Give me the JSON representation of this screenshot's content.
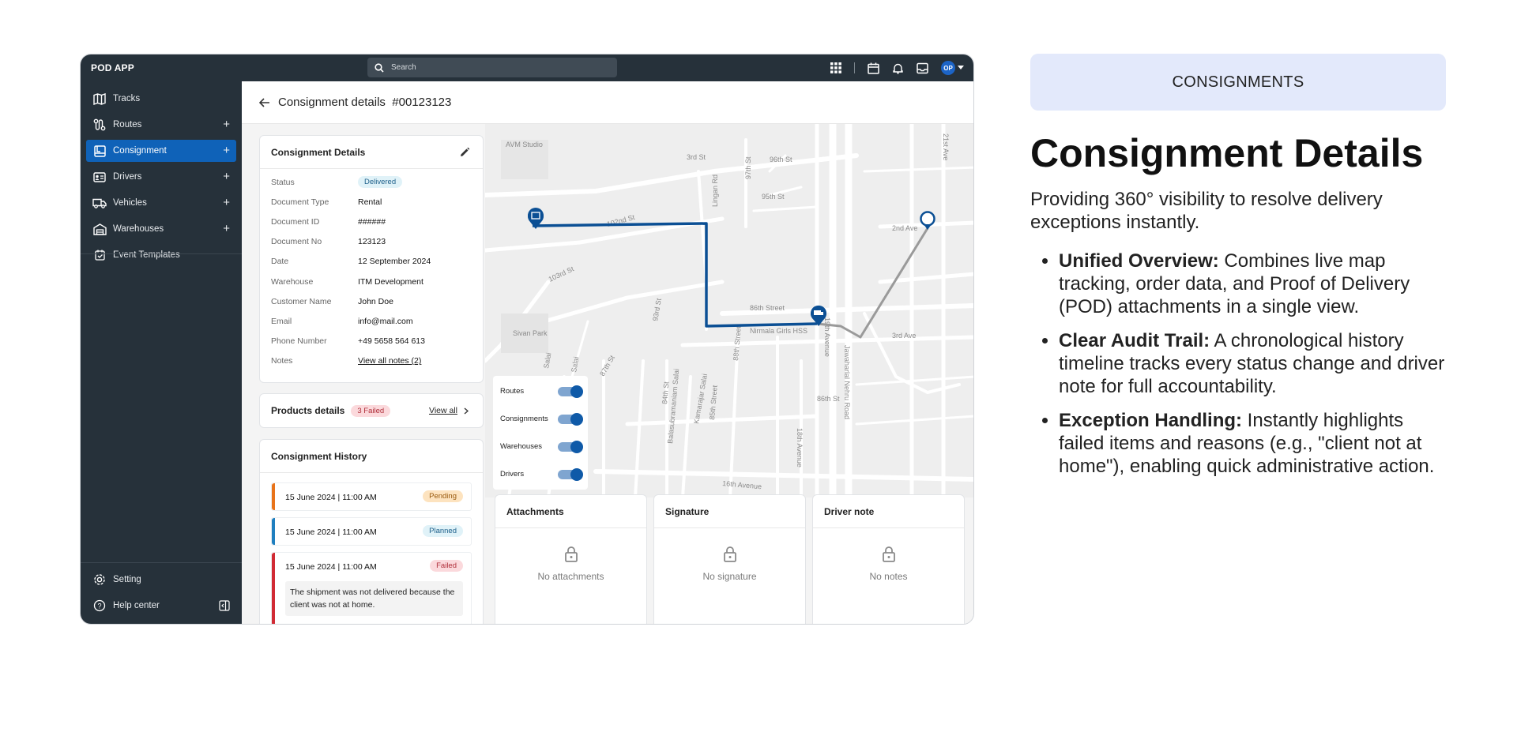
{
  "app": {
    "brand": "POD APP",
    "search_placeholder": "Search",
    "avatar_initials": "OP"
  },
  "sidebar": {
    "items": [
      {
        "label": "Tracks",
        "icon": "map-icon"
      },
      {
        "label": "Routes",
        "icon": "route-icon"
      },
      {
        "label": "Consignment",
        "icon": "consignment-icon"
      },
      {
        "label": "Drivers",
        "icon": "id-card-icon"
      },
      {
        "label": "Vehicles",
        "icon": "truck-icon"
      },
      {
        "label": "Warehouses",
        "icon": "warehouse-icon"
      },
      {
        "label": "Event Templates",
        "icon": "template-icon"
      }
    ],
    "bottom": [
      {
        "label": "Setting",
        "icon": "gear-icon"
      },
      {
        "label": "Help center",
        "icon": "help-icon"
      }
    ]
  },
  "page": {
    "title": "Consignment details",
    "id": "#00123123"
  },
  "details": {
    "title": "Consignment Details",
    "rows": [
      {
        "k": "Status",
        "v": "Delivered"
      },
      {
        "k": "Document Type",
        "v": "Rental"
      },
      {
        "k": "Document ID",
        "v": "######"
      },
      {
        "k": "Document No",
        "v": "123123"
      },
      {
        "k": "Date",
        "v": "12 September 2024"
      },
      {
        "k": "Warehouse",
        "v": "ITM Development"
      },
      {
        "k": "Customer Name",
        "v": "John Doe"
      },
      {
        "k": "Email",
        "v": "info@mail.com"
      },
      {
        "k": "Phone Number",
        "v": "+49 5658 564 613"
      },
      {
        "k": "Notes",
        "v": "View all notes (2)"
      }
    ]
  },
  "products": {
    "title": "Products details",
    "badge": "3 Failed",
    "link": "View all"
  },
  "history": {
    "title": "Consignment History",
    "items": [
      {
        "date": "15 June 2024 | 11:00 AM",
        "status": "Pending",
        "color": "#e8731a"
      },
      {
        "date": "15 June 2024 | 11:00 AM",
        "status": "Planned",
        "color": "#1f7fbf"
      },
      {
        "date": "15 June 2024 | 11:00 AM",
        "status": "Failed",
        "color": "#d12b34",
        "note": "The shipment was not delivered because the client was not at home."
      }
    ]
  },
  "map": {
    "labels": [
      "AVM Studio",
      "3rd St",
      "96th St",
      "97th St",
      "95th St",
      "21st Ave",
      "102nd St",
      "Lingan Rd",
      "2nd Ave",
      "103rd St",
      "86th Street",
      "Sivan Park",
      "93rd St",
      "Nirmala Girls HSS",
      "19th Avenue",
      "3rd Ave",
      "Salai",
      "Salai",
      "87th St",
      "84th St",
      "Balasubramaniam Salai",
      "Kamarajar Salai",
      "85th Street",
      "88th Street",
      "86th St",
      "Jawaharlal Nehru Road",
      "18th Avenue",
      "16th Avenue"
    ],
    "toggles": [
      "Routes",
      "Consignments",
      "Warehouses",
      "Drivers"
    ]
  },
  "bottom_cards": [
    {
      "title": "Attachments",
      "empty": "No attachments"
    },
    {
      "title": "Signature",
      "empty": "No signature"
    },
    {
      "title": "Driver note",
      "empty": "No notes"
    }
  ],
  "panel": {
    "tag": "CONSIGNMENTS",
    "heading": "Consignment Details",
    "lead": "Providing 360° visibility to resolve delivery exceptions instantly.",
    "bullets": [
      {
        "strong": "Unified Overview:",
        "text": " Combines live map tracking, order data, and Proof of Delivery (POD) attachments in a single view."
      },
      {
        "strong": "Clear Audit Trail:",
        "text": " A chronological history timeline tracks every status change and driver note for full accountability."
      },
      {
        "strong": "Exception Handling:",
        "text": " Instantly highlights failed items and reasons (e.g., \"client not at home\"), enabling quick administrative action."
      }
    ]
  },
  "colors": {
    "sidebar": "#26313a",
    "accent": "#0f62b8",
    "route_active": "#0b4f94",
    "route_pending": "#9a9a9a"
  }
}
